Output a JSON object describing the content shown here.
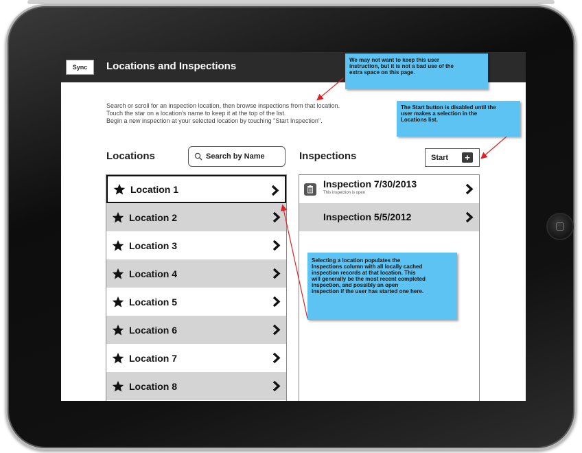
{
  "header": {
    "sync_label": "Sync",
    "title": "Locations and Inspections"
  },
  "instructions": [
    "Search or scroll for an inspection location, then browse inspections from that location.",
    "Touch the star on a location's name to keep it at the top of the list.",
    "Begin a new inspection at your selected location by touching \"Start Inspection\"."
  ],
  "locations": {
    "heading": "Locations",
    "search_placeholder": "Search by Name",
    "items": [
      {
        "label": "Location 1"
      },
      {
        "label": "Location 2"
      },
      {
        "label": "Location 3"
      },
      {
        "label": "Location 4"
      },
      {
        "label": "Location 5"
      },
      {
        "label": "Location 6"
      },
      {
        "label": "Location 7"
      },
      {
        "label": "Location 8"
      }
    ]
  },
  "inspections": {
    "heading": "Inspections",
    "start_label": "Start",
    "start_icon": "plus-icon",
    "items": [
      {
        "title": "Inspection 7/30/2013",
        "subtitle": "This inspection is open"
      },
      {
        "title": "Inspection 5/5/2012",
        "subtitle": ""
      }
    ]
  },
  "callouts": {
    "top": [
      "We may not want to keep this user",
      "instruction, but it is not a bad use of the",
      "extra space on this page."
    ],
    "start": [
      "The Start button is disabled until the",
      "user makes a selection in the",
      "Locations list."
    ],
    "locations": [
      "Selecting a location populates the",
      "Inspections column with all locally cached",
      "inspection records at that location.  This",
      "will generally be the most recent completed",
      "inspection, and possibly an open",
      "inspection if the user has started one here."
    ]
  },
  "colors": {
    "header_bg": "#2b2b2b",
    "callout_bg": "#5cc3f2",
    "alt_row_bg": "#d4d4d4",
    "arrow": "#e02020"
  }
}
